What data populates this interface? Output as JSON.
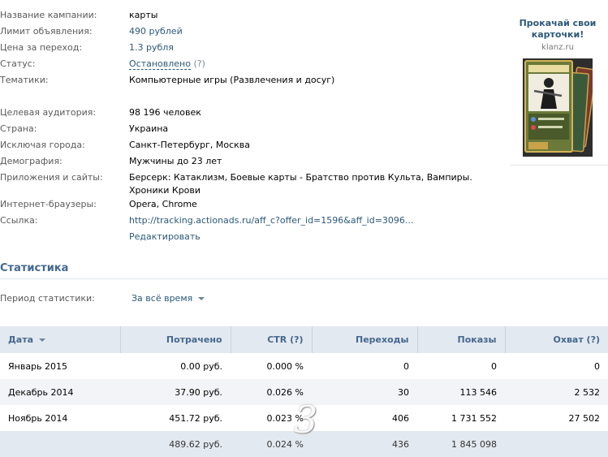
{
  "campaign": {
    "name_label": "Название кампании:",
    "name_value": "карты",
    "limit_label": "Лимит объявления:",
    "limit_value": "490 рублей",
    "price_label": "Цена за переход:",
    "price_value": "1.3 рубля",
    "status_label": "Статус:",
    "status_value": "Остановлено",
    "status_help": "(?)",
    "topics_label": "Тематики:",
    "topics_value": "Компьютерные игры (Развлечения и досуг)",
    "audience_label": "Целевая аудитория:",
    "audience_value": "98 196 человек",
    "country_label": "Страна:",
    "country_value": "Украина",
    "excluded_label": "Исключая города:",
    "excluded_value": "Санкт-Петербург, Москва",
    "demography_label": "Демография:",
    "demography_value": "Мужчины до 23 лет",
    "apps_label": "Приложения и сайты:",
    "apps_value_line1": "Берсерк: Катаклизм, Боевые карты - Братство против Культа, Вампиры.",
    "apps_value_line2": "Хроники Крови",
    "browsers_label": "Интернет-браузеры:",
    "browsers_value": "Opera, Chrome",
    "link_label": "Ссылка:",
    "link_value": "http://tracking.actionads.ru/aff_c?offer_id=1596&aff_id=3096...",
    "edit_label": "Редактировать"
  },
  "ad_preview": {
    "title": "Прокачай свои карточки!",
    "domain": "klanz.ru"
  },
  "statistics": {
    "title": "Статистика",
    "period_label": "Период статистики:",
    "period_value": "За всё время",
    "columns": [
      "Дата",
      "Потрачено",
      "CTR (?)",
      "Переходы",
      "Показы",
      "Охват (?)"
    ],
    "rows": [
      [
        "Январь 2015",
        "0.00 руб.",
        "0.000 %",
        "0",
        "0",
        "0"
      ],
      [
        "Декабрь 2014",
        "37.90 руб.",
        "0.026 %",
        "30",
        "113 546",
        "2 532"
      ],
      [
        "Ноябрь 2014",
        "451.72 руб.",
        "0.023 %",
        "406",
        "1 731 552",
        "27 502"
      ]
    ],
    "total": [
      "",
      "489.62 руб.",
      "0.024 %",
      "436",
      "1 845 098",
      ""
    ]
  },
  "watermark": "3"
}
